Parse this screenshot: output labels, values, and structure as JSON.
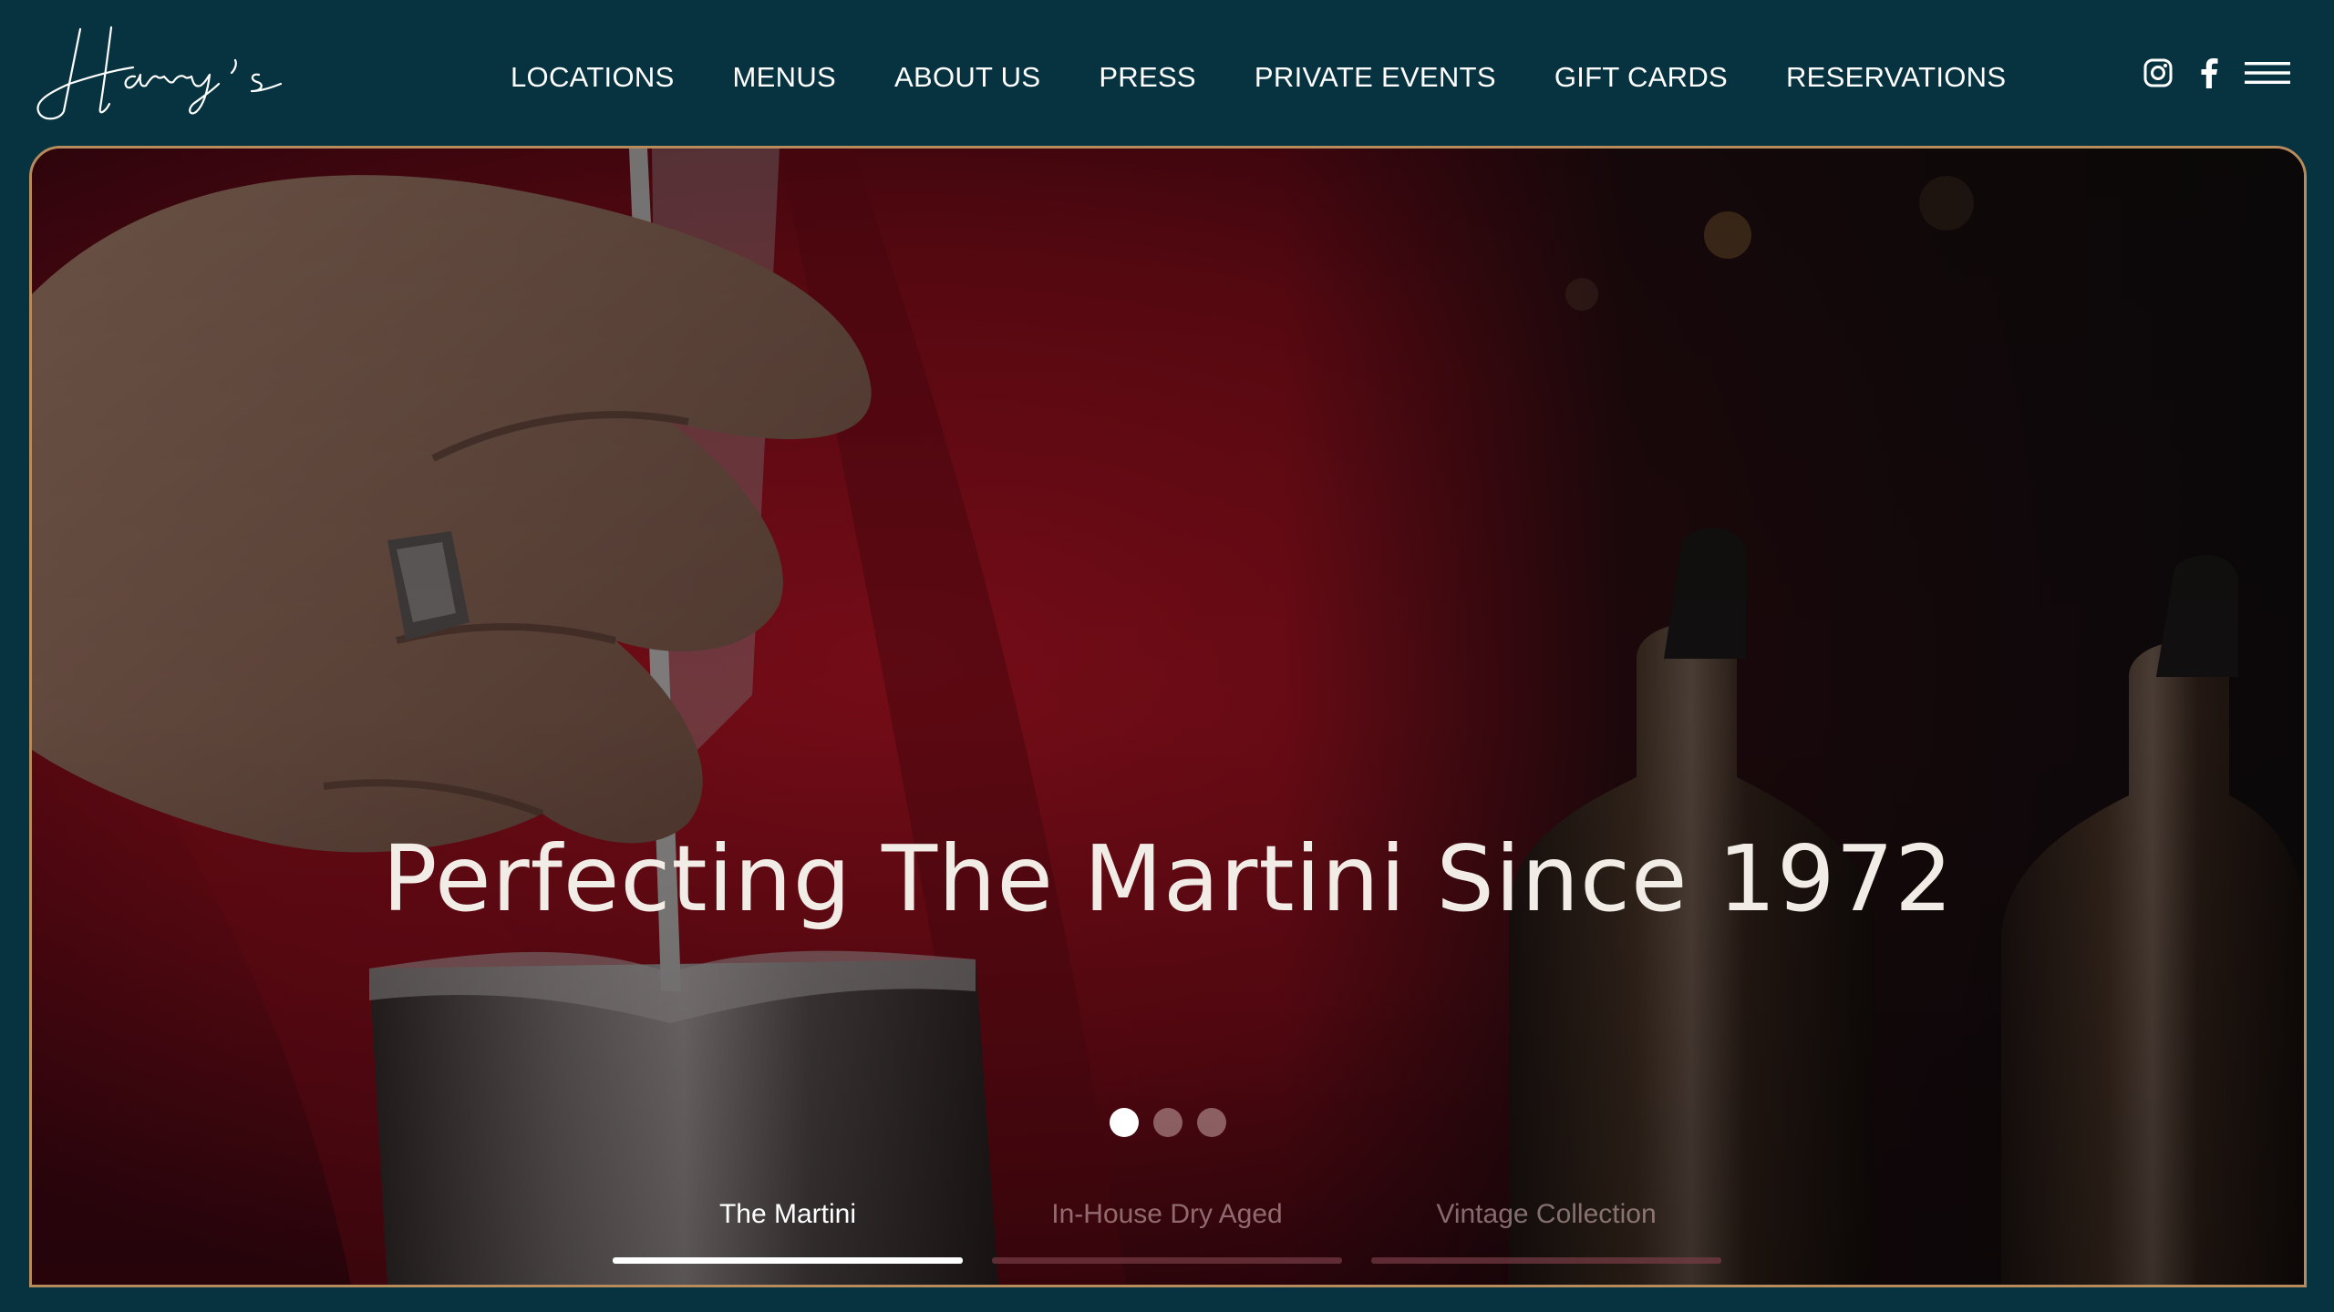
{
  "brand": {
    "logo_text": "Harry's"
  },
  "nav": {
    "items": [
      {
        "label": "LOCATIONS"
      },
      {
        "label": "MENUS"
      },
      {
        "label": "ABOUT US"
      },
      {
        "label": "PRESS"
      },
      {
        "label": "PRIVATE EVENTS"
      },
      {
        "label": "GIFT CARDS"
      },
      {
        "label": "RESERVATIONS"
      }
    ]
  },
  "header_icons": [
    {
      "name": "instagram-icon"
    },
    {
      "name": "facebook-icon"
    },
    {
      "name": "hamburger-menu-icon"
    }
  ],
  "hero": {
    "title": "Perfecting The Martini Since 1972",
    "slide_count": 3,
    "active_slide": 1,
    "tabs": [
      {
        "label": "The Martini",
        "active": true
      },
      {
        "label": "In-House Dry Aged",
        "active": false
      },
      {
        "label": "Vintage Collection",
        "active": false
      }
    ]
  },
  "colors": {
    "background": "#073341",
    "hero_border": "#b88b5d",
    "text": "#ffffff",
    "hero_title": "#f1ece6"
  }
}
